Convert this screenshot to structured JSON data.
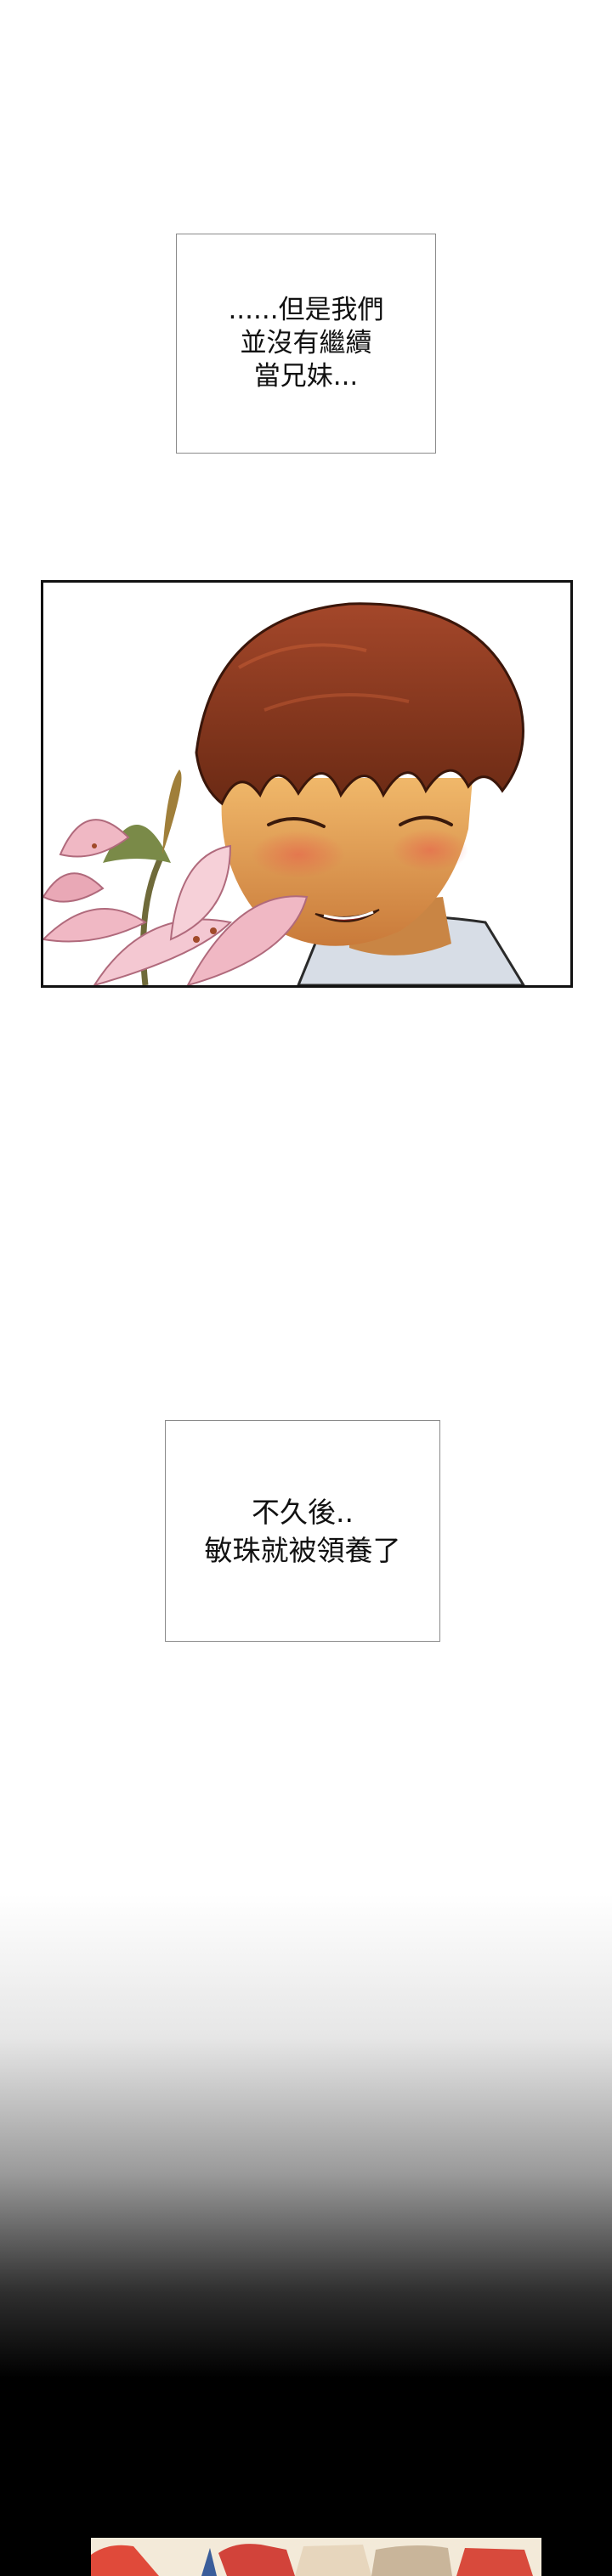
{
  "captions": [
    {
      "lines": [
        "......但是我們",
        "並沒有繼續",
        "當兄妹..."
      ]
    },
    {
      "lines": [
        "不久後..",
        "敏珠就被領養了"
      ]
    }
  ],
  "colors": {
    "background_top": "#ffffff",
    "background_bottom": "#000000",
    "hair": "#8b3a1e",
    "skin": "#e3a35c",
    "lily": "#f0b8c4"
  },
  "icons": {
    "panel_1": "smiling-boy-with-lilies-illustration",
    "panel_2": "partial-next-panel-illustration"
  }
}
